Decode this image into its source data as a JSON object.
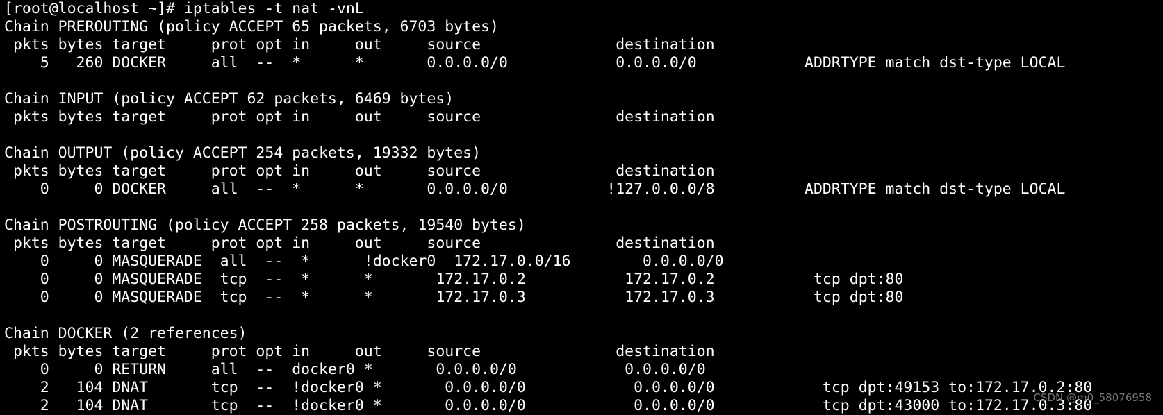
{
  "colors": {
    "background": "#000000",
    "text": "#ffffff",
    "watermark": "#8a8a8a"
  },
  "terminal": {
    "lines": [
      "[root@localhost ~]# iptables -t nat -vnL",
      "Chain PREROUTING (policy ACCEPT 65 packets, 6703 bytes)",
      " pkts bytes target     prot opt in     out     source               destination",
      "    5   260 DOCKER     all  --  *      *       0.0.0.0/0            0.0.0.0/0            ADDRTYPE match dst-type LOCAL",
      "",
      "Chain INPUT (policy ACCEPT 62 packets, 6469 bytes)",
      " pkts bytes target     prot opt in     out     source               destination",
      "",
      "Chain OUTPUT (policy ACCEPT 254 packets, 19332 bytes)",
      " pkts bytes target     prot opt in     out     source               destination",
      "    0     0 DOCKER     all  --  *      *       0.0.0.0/0           !127.0.0.0/8          ADDRTYPE match dst-type LOCAL",
      "",
      "Chain POSTROUTING (policy ACCEPT 258 packets, 19540 bytes)",
      " pkts bytes target     prot opt in     out     source               destination",
      "    0     0 MASQUERADE  all  --  *      !docker0  172.17.0.0/16        0.0.0.0/0",
      "    0     0 MASQUERADE  tcp  --  *      *       172.17.0.2           172.17.0.2           tcp dpt:80",
      "    0     0 MASQUERADE  tcp  --  *      *       172.17.0.3           172.17.0.3           tcp dpt:80",
      "",
      "Chain DOCKER (2 references)",
      " pkts bytes target     prot opt in     out     source               destination",
      "    0     0 RETURN     all  --  docker0 *       0.0.0.0/0            0.0.0.0/0",
      "    2   104 DNAT       tcp  --  !docker0 *       0.0.0.0/0            0.0.0.0/0            tcp dpt:49153 to:172.17.0.2:80",
      "    2   104 DNAT       tcp  --  !docker0 *       0.0.0.0/0            0.0.0.0/0            tcp dpt:43000 to:172.17.0.3:80"
    ]
  },
  "watermark": {
    "text": "CSDN @m0_58076958"
  }
}
